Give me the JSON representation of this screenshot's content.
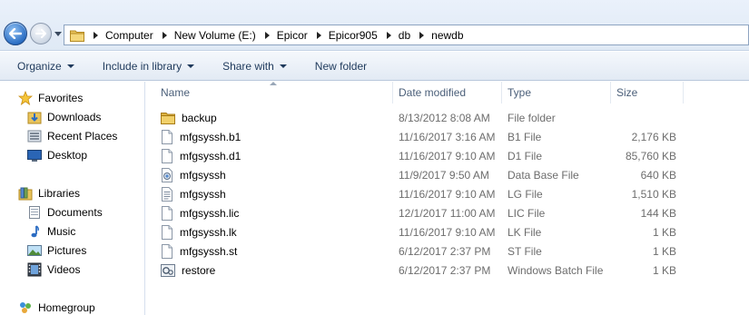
{
  "address": {
    "crumbs": [
      "Computer",
      "New Volume (E:)",
      "Epicor",
      "Epicor905",
      "db",
      "newdb"
    ]
  },
  "toolbar": {
    "organize": "Organize",
    "include_in_library": "Include in library",
    "share_with": "Share with",
    "new_folder": "New folder"
  },
  "nav": {
    "favorites": "Favorites",
    "downloads": "Downloads",
    "recent_places": "Recent Places",
    "desktop": "Desktop",
    "libraries": "Libraries",
    "documents": "Documents",
    "music": "Music",
    "pictures": "Pictures",
    "videos": "Videos",
    "homegroup": "Homegroup"
  },
  "columns": {
    "name": "Name",
    "date_modified": "Date modified",
    "type": "Type",
    "size": "Size"
  },
  "files": [
    {
      "name": "backup",
      "date": "8/13/2012 8:08 AM",
      "type": "File folder",
      "size": "",
      "icon": "folder-icon"
    },
    {
      "name": "mfgsyssh.b1",
      "date": "11/16/2017 3:16 AM",
      "type": "B1 File",
      "size": "2,176 KB",
      "icon": "file-icon"
    },
    {
      "name": "mfgsyssh.d1",
      "date": "11/16/2017 9:10 AM",
      "type": "D1 File",
      "size": "85,760 KB",
      "icon": "file-icon"
    },
    {
      "name": "mfgsyssh",
      "date": "11/9/2017 9:50 AM",
      "type": "Data Base File",
      "size": "640 KB",
      "icon": "database-file-icon"
    },
    {
      "name": "mfgsyssh",
      "date": "11/16/2017 9:10 AM",
      "type": "LG File",
      "size": "1,510 KB",
      "icon": "text-file-icon"
    },
    {
      "name": "mfgsyssh.lic",
      "date": "12/1/2017 11:00 AM",
      "type": "LIC File",
      "size": "144 KB",
      "icon": "file-icon"
    },
    {
      "name": "mfgsyssh.lk",
      "date": "11/16/2017 9:10 AM",
      "type": "LK File",
      "size": "1 KB",
      "icon": "file-icon"
    },
    {
      "name": "mfgsyssh.st",
      "date": "6/12/2017 2:37 PM",
      "type": "ST File",
      "size": "1 KB",
      "icon": "file-icon"
    },
    {
      "name": "restore",
      "date": "6/12/2017 2:37 PM",
      "type": "Windows Batch File",
      "size": "1 KB",
      "icon": "batch-file-icon"
    }
  ]
}
